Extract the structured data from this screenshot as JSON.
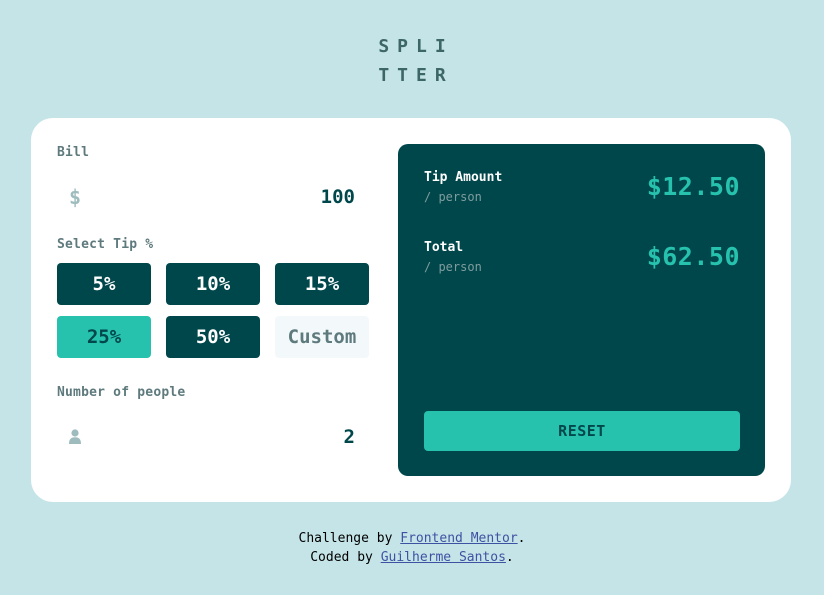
{
  "logo": {
    "line1": "SPLI",
    "line2": "TTER"
  },
  "bill": {
    "label": "Bill",
    "currency_symbol": "$",
    "value": "100"
  },
  "tip": {
    "label": "Select Tip %",
    "options": [
      "5%",
      "10%",
      "15%",
      "25%",
      "50%"
    ],
    "selected": "25%",
    "custom_placeholder": "Custom"
  },
  "people": {
    "label": "Number of people",
    "icon": "person-icon",
    "value": "2"
  },
  "results": {
    "tip_amount": {
      "label": "Tip Amount",
      "sub": "/ person",
      "value": "$12.50"
    },
    "total": {
      "label": "Total",
      "sub": "/ person",
      "value": "$62.50"
    },
    "reset_label": "RESET"
  },
  "attribution": {
    "line1_prefix": "Challenge by ",
    "line1_link": "Frontend Mentor",
    "line1_suffix": ".",
    "line2_prefix": "Coded by ",
    "line2_link": "Guilherme Santos",
    "line2_suffix": "."
  },
  "colors": {
    "background": "#c5e4e7",
    "dark_cyan": "#00474b",
    "strong_cyan": "#26c2ae",
    "grayish_cyan": "#5e7a7d",
    "white": "#ffffff"
  }
}
